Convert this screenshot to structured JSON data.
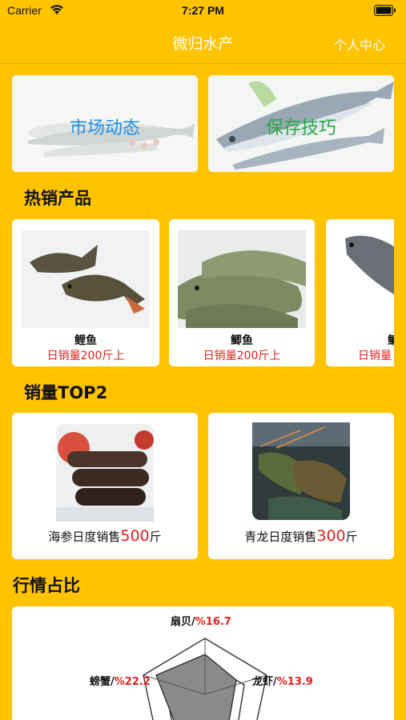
{
  "status": {
    "carrier": "Carrier",
    "time": "7:27 PM"
  },
  "nav": {
    "title": "微归水产",
    "right_link": "个人中心"
  },
  "banners": [
    {
      "label": "市场动态",
      "color": "#1E90E8"
    },
    {
      "label": "保存技巧",
      "color": "#27A845"
    }
  ],
  "hot": {
    "title": "热销产品",
    "items": [
      {
        "name": "鲤鱼",
        "sales": "日销量200斤上"
      },
      {
        "name": "鲫鱼",
        "sales": "日销量200斤上"
      },
      {
        "name": "鳙",
        "sales": "日销量"
      }
    ]
  },
  "top": {
    "title": "销量TOP2",
    "items": [
      {
        "prefix": "海参日度销售",
        "value": "500",
        "unit": "斤"
      },
      {
        "prefix": "青龙日度销售",
        "value": "300",
        "unit": "斤"
      }
    ]
  },
  "market": {
    "title": "行情占比",
    "labels": [
      {
        "name": "扇贝/",
        "value": "%16.7"
      },
      {
        "name": "龙虾/",
        "value": "%13.9"
      },
      {
        "name": "螃蟹/",
        "value": "%22.2"
      }
    ]
  }
}
